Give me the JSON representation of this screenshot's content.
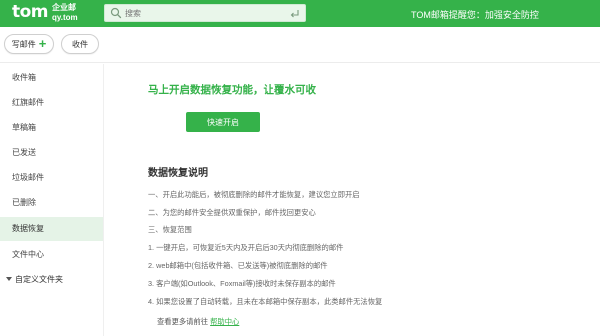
{
  "header": {
    "logo_main": "tom",
    "logo_cn": "企业邮",
    "logo_domain": "qy.tom",
    "search_placeholder": "搜索",
    "notice_prefix": "TOM邮箱提醒您：",
    "notice_link": "加强安全防控",
    "bg_color": "#35b24a"
  },
  "toolbar": {
    "compose_label": "写邮件",
    "receive_label": "收件"
  },
  "sidebar": {
    "items": [
      {
        "label": "收件箱"
      },
      {
        "label": "红旗邮件"
      },
      {
        "label": "草稿箱"
      },
      {
        "label": "已发送"
      },
      {
        "label": "垃圾邮件"
      },
      {
        "label": "已删除"
      },
      {
        "label": "数据恢复"
      },
      {
        "label": "文件中心"
      }
    ],
    "folder_label": "自定义文件夹",
    "active_index": 6
  },
  "main": {
    "title": "马上开启数据恢复功能，让覆水可收",
    "enable_button": "快速开启",
    "explain_title": "数据恢复说明",
    "lines": [
      "一、开启此功能后，被彻底删除的邮件才能恢复，建议您立即开启",
      "二、为您的邮件安全提供双重保护，邮件找回更安心",
      "三、恢复范围",
      "1. 一键开启，可恢复近5天内及开启后30天内彻底删除的邮件",
      "2. web邮箱中(包括收件箱、已发送等)被彻底删除的邮件",
      "3. 客户端(如Outlook、Foxmail等)接收时未保存副本的邮件",
      "4. 如果您设置了自动转载，且未在本邮箱中保存副本，此类邮件无法恢复"
    ],
    "more_prefix": "查看更多请前往",
    "more_link": "帮助中心"
  }
}
